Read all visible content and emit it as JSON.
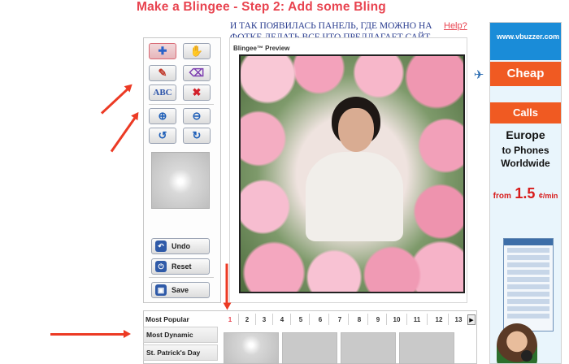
{
  "header": {
    "title": "Make a Blingee - Step 2: Add some Bling",
    "annotation": "И ТАК ПОЯВИЛАСЬ ПАНЕЛЬ, ГДЕ МОЖНО НА ФОТКЕ ДЕЛАТЬ ВСЕ ЧТО ПРЕДЛАГАЕТ САЙТ",
    "help_link": "Help?"
  },
  "toolbar": {
    "tools": [
      {
        "icon": "plus-icon",
        "glyph": "✚"
      },
      {
        "icon": "hand-icon",
        "glyph": "✋"
      },
      {
        "icon": "brush-icon",
        "glyph": "✎"
      },
      {
        "icon": "eraser-icon",
        "glyph": "⌫"
      },
      {
        "icon": "text-abc-icon",
        "glyph": "ABC"
      },
      {
        "icon": "delete-x-icon",
        "glyph": "✖"
      },
      {
        "icon": "zoom-in-icon",
        "glyph": "⊕"
      },
      {
        "icon": "zoom-out-icon",
        "glyph": "⊖"
      },
      {
        "icon": "rotate-left-icon",
        "glyph": "↺"
      },
      {
        "icon": "rotate-right-icon",
        "glyph": "↻"
      }
    ],
    "undo_label": "Undo",
    "reset_label": "Reset",
    "save_label": "Save"
  },
  "preview": {
    "label": "Blingee™ Preview"
  },
  "stamps": {
    "categories": [
      "Most Popular",
      "Most Dynamic",
      "St. Patrick's Day"
    ],
    "pages": [
      "1",
      "2",
      "3",
      "4",
      "5",
      "6",
      "7",
      "8",
      "9",
      "10",
      "11",
      "12",
      "13"
    ],
    "active_page": "1"
  },
  "ad": {
    "brand": "www.vbuzzer.com",
    "cheap": "Cheap",
    "calls": "Calls",
    "line1": "Europe",
    "line2": "to Phones",
    "line3": "Worldwide",
    "price_prefix": "from",
    "price": "1.5",
    "price_unit": "¢/min"
  },
  "colors": {
    "accent_red": "#e8434f",
    "annotation_blue": "#2a3d8f",
    "arrow_red": "#ec3a24",
    "ad_orange": "#f05a22"
  }
}
